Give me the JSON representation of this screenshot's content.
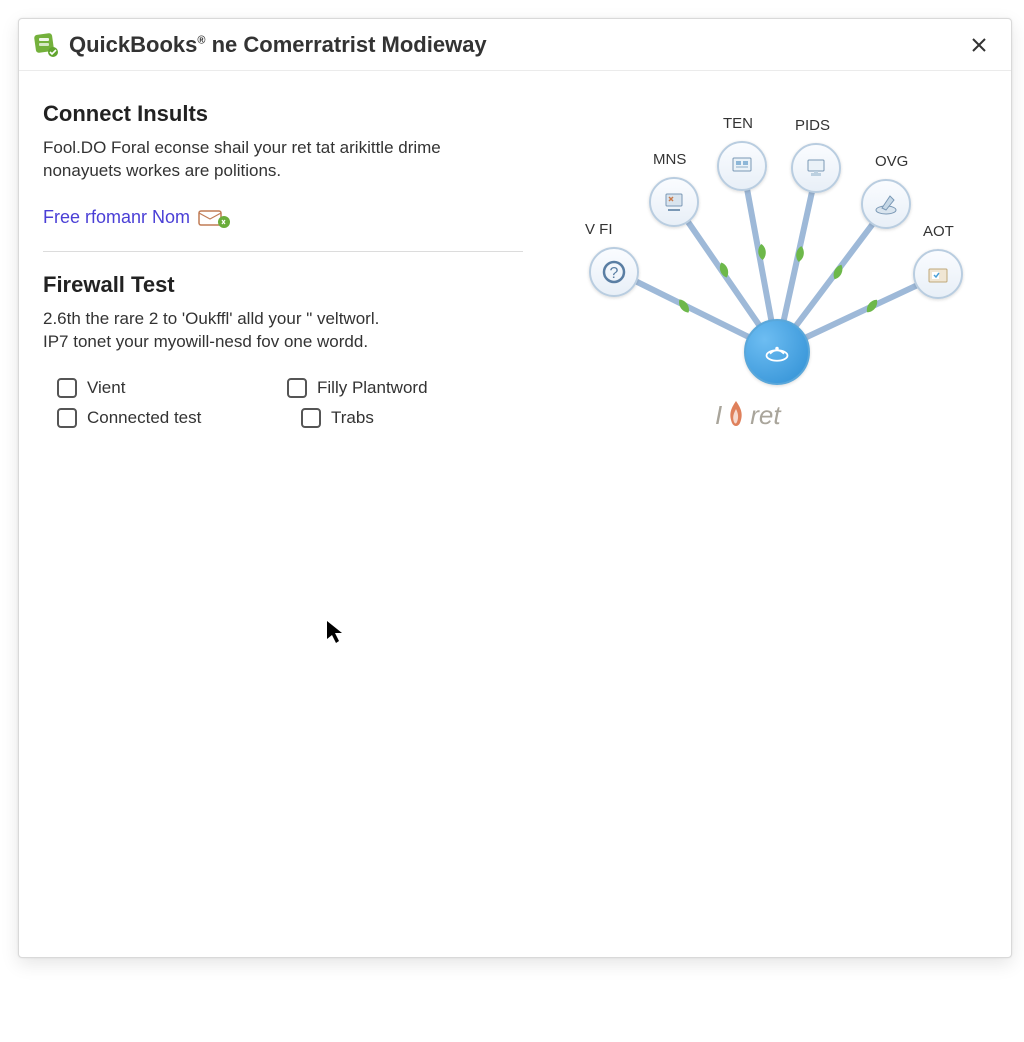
{
  "window": {
    "title_prefix": "QuickBooks",
    "title_suffix": " ne Comerratrist Modieway"
  },
  "section1": {
    "title": "Connect Insults",
    "desc": "Fool.DO Foral econse shail your ret tat arikittle drime nonayuets workes are politions.",
    "link": "Free rfomanr Nom"
  },
  "section2": {
    "title": "Firewall Test",
    "desc_line1": "2.6th the rare 2 to 'Oukffl' alld your \" veltworl.",
    "desc_line2": "IP7 tonet your myowill-nesd fov one wordd.",
    "checkboxes": {
      "r1c1": "Vient",
      "r1c2": "Filly Plantword",
      "r2c1": "Connected test",
      "r2c2": "Trabs"
    }
  },
  "diagram": {
    "nodes": [
      "V FI",
      "MNS",
      "TEN",
      "PIDS",
      "OVG",
      "AOT"
    ],
    "brand_prefix": "I",
    "brand_suffix": "ret"
  }
}
